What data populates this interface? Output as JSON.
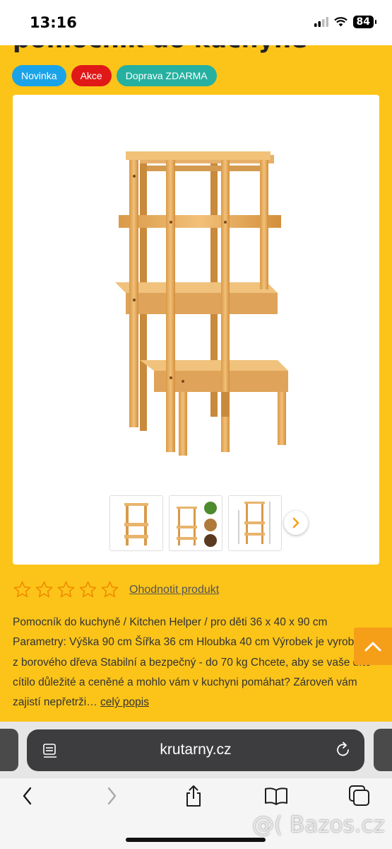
{
  "status": {
    "time": "13:16",
    "battery": "84"
  },
  "page": {
    "title_partial": "pomocník do kuchyně",
    "badges": [
      {
        "label": "Novinka",
        "color": "#1aa3e8"
      },
      {
        "label": "Akce",
        "color": "#e01818"
      },
      {
        "label": "Doprava ZDARMA",
        "color": "#26b0a0"
      }
    ],
    "gallery": {
      "main_image": "wooden-learning-tower-image",
      "thumbnails": [
        "thumbnail-tower-front",
        "thumbnail-tower-features",
        "thumbnail-tower-dimensions"
      ],
      "next_icon": "chevron-right-icon"
    },
    "rating": {
      "stars_filled": 0,
      "stars_total": 5,
      "rate_label": "Ohodnotit produkt"
    },
    "description": {
      "text": "Pomocník do kuchyně / Kitchen Helper / pro děti 36 x 40 x 90 cm Parametry: Výška 90 cm Šířka 36 cm Hloubka 40 cm Výrobek je vyrobený z borového dřeva Stabilní a bezpečný - do 70 kg Chcete, aby se vaše dítě cítilo důležité a ceněné a mohlo vám v kuchyni pomáhat? Zároveň vám zajistí nepřetrži…",
      "more_label": "celý popis"
    }
  },
  "colors": {
    "background": "#fcc419",
    "accent": "#f59f19"
  },
  "browser": {
    "url": "krutarny.cz"
  },
  "watermark": "@( Bazos.cz"
}
